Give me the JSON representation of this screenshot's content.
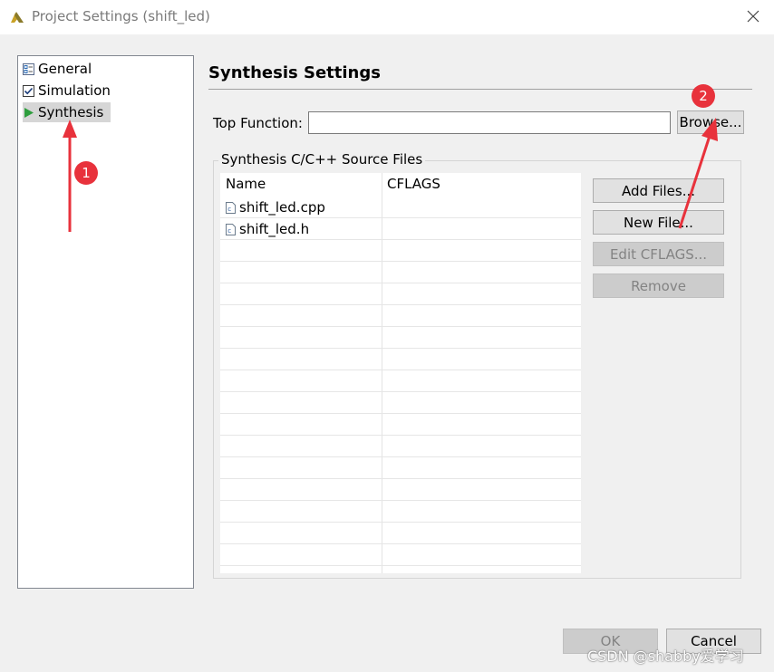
{
  "window": {
    "title": "Project Settings (shift_led)"
  },
  "nav": {
    "items": [
      {
        "label": "General"
      },
      {
        "label": "Simulation"
      },
      {
        "label": "Synthesis"
      }
    ]
  },
  "synthesis": {
    "title": "Synthesis Settings",
    "top_function_label": "Top Function:",
    "top_function_value": "",
    "browse_label": "Browse...",
    "source_group_label": "Synthesis C/C++ Source Files",
    "columns": [
      "Name",
      "CFLAGS"
    ],
    "files": [
      {
        "name": "shift_led.cpp",
        "cflags": ""
      },
      {
        "name": "shift_led.h",
        "cflags": ""
      }
    ],
    "buttons": {
      "add_files": "Add Files...",
      "new_file": "New File...",
      "edit_cflags": "Edit CFLAGS...",
      "remove": "Remove"
    }
  },
  "footer": {
    "ok_label": "OK",
    "cancel_label": "Cancel"
  },
  "annotations": {
    "badge1": "1",
    "badge2": "2",
    "arrow_color": "#e8323c"
  },
  "watermark": "CSDN @shabby爱学习",
  "colors": {
    "accent_arrow": "#e8323c",
    "nav_selected_bg": "#d6d6d6",
    "synthesis_icon": "#2e9e3e"
  }
}
